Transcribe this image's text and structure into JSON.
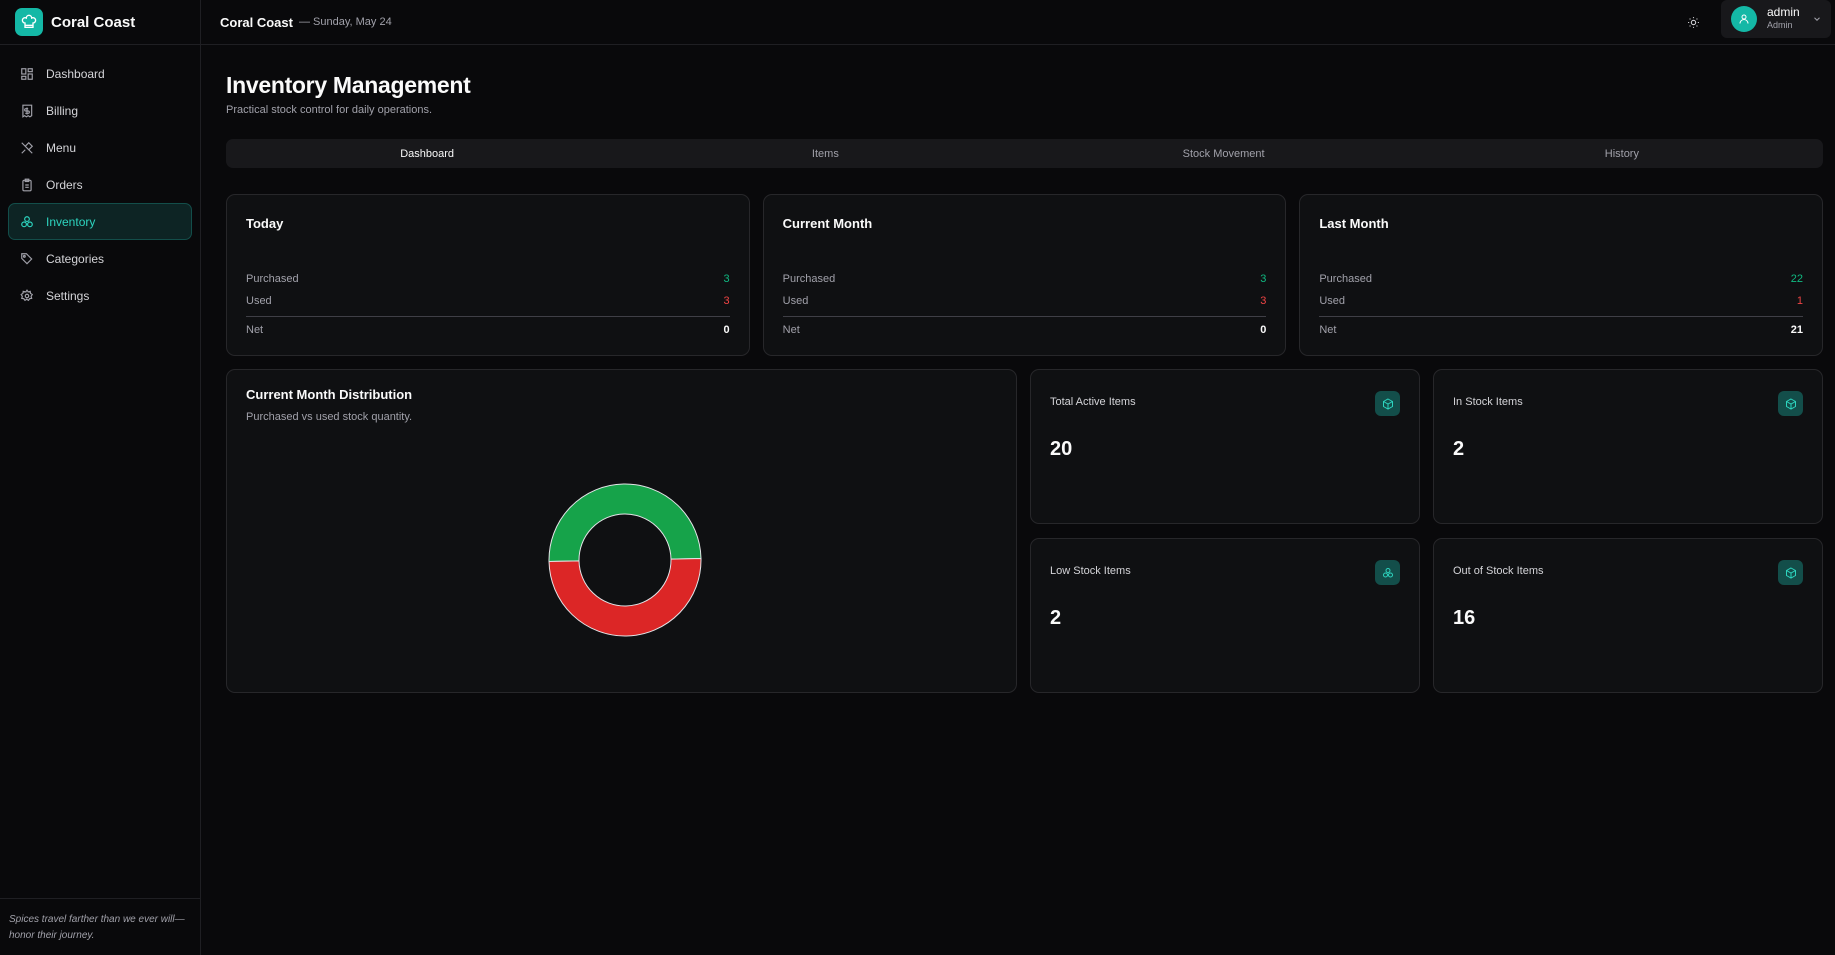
{
  "brand": {
    "name": "Coral Coast"
  },
  "header": {
    "title": "Coral Coast",
    "date": "— Sunday, May 24"
  },
  "user": {
    "name": "admin",
    "role": "Admin"
  },
  "sidebar": {
    "items": [
      {
        "label": "Dashboard",
        "icon": "grid-icon"
      },
      {
        "label": "Billing",
        "icon": "receipt-icon"
      },
      {
        "label": "Menu",
        "icon": "utensils-icon"
      },
      {
        "label": "Orders",
        "icon": "clipboard-icon"
      },
      {
        "label": "Inventory",
        "icon": "boxes-icon",
        "active": true
      },
      {
        "label": "Categories",
        "icon": "tag-icon"
      },
      {
        "label": "Settings",
        "icon": "gear-icon"
      }
    ],
    "quote": "Spices travel farther than we ever will—honor their journey."
  },
  "page": {
    "title": "Inventory Management",
    "subtitle": "Practical stock control for daily operations."
  },
  "tabs": [
    "Dashboard",
    "Items",
    "Stock Movement",
    "History"
  ],
  "stats": [
    {
      "title": "Today",
      "purchased_label": "Purchased",
      "purchased": "3",
      "used_label": "Used",
      "used": "3",
      "net_label": "Net",
      "net": "0"
    },
    {
      "title": "Current Month",
      "purchased_label": "Purchased",
      "purchased": "3",
      "used_label": "Used",
      "used": "3",
      "net_label": "Net",
      "net": "0"
    },
    {
      "title": "Last Month",
      "purchased_label": "Purchased",
      "purchased": "22",
      "used_label": "Used",
      "used": "1",
      "net_label": "Net",
      "net": "21"
    }
  ],
  "distribution": {
    "title": "Current Month Distribution",
    "subtitle": "Purchased vs used stock quantity."
  },
  "chart_data": {
    "type": "pie",
    "categories": [
      "Purchased",
      "Used"
    ],
    "values": [
      3,
      3
    ],
    "colors": [
      "#16a34a",
      "#dc2626"
    ],
    "title": "Current Month Distribution"
  },
  "kpis": [
    {
      "label": "Total Active Items",
      "value": "20",
      "icon": "package-icon"
    },
    {
      "label": "In Stock Items",
      "value": "2",
      "icon": "package-icon"
    },
    {
      "label": "Low Stock Items",
      "value": "2",
      "icon": "boxes-icon"
    },
    {
      "label": "Out of Stock Items",
      "value": "16",
      "icon": "package-icon"
    }
  ],
  "colors": {
    "accent": "#14b8a6",
    "green": "#10b981",
    "red": "#ef4444",
    "background": "#09090b"
  }
}
